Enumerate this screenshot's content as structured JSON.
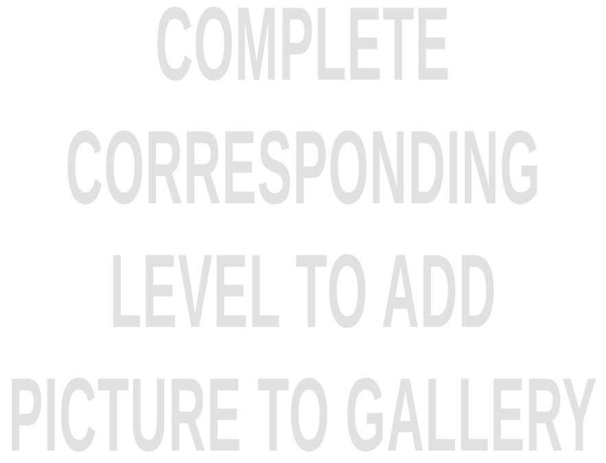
{
  "locked_message": {
    "lines": [
      "COMPLETE",
      "CORRESPONDING",
      "LEVEL TO ADD",
      "PICTURE TO GALLERY"
    ],
    "text_color": "#e1e1e1",
    "background_color": "#ffffff"
  }
}
